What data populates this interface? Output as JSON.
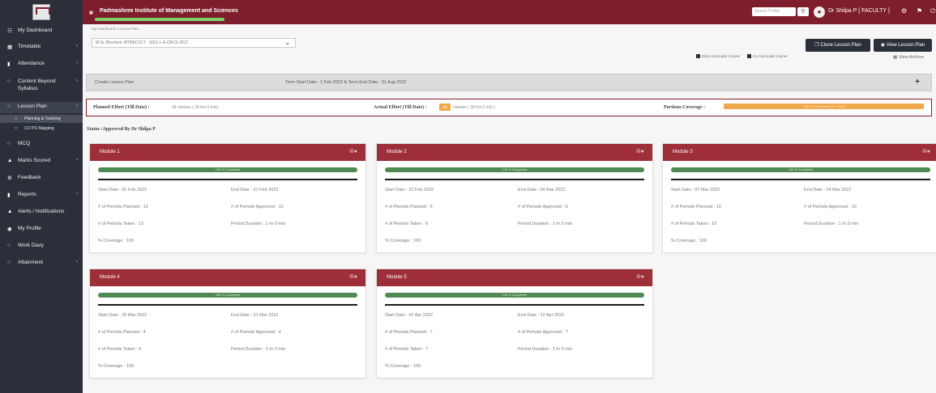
{
  "header": {
    "institute_name": "Padmashree Institute of Management and Sciences",
    "search_placeholder": "Search Profile",
    "user_label": "Dr Shilpa P [ FACULTY ]"
  },
  "sidebar": {
    "items": [
      {
        "label": "My Dashboard",
        "icon": "dashboard-icon"
      },
      {
        "label": "Timetable",
        "icon": "calendar-icon"
      },
      {
        "label": "Attendance",
        "icon": "chart-icon"
      },
      {
        "label": "Content Beyond Syllabus",
        "icon": "circle-icon"
      },
      {
        "label": "Lesson Plan",
        "icon": "circle-icon"
      },
      {
        "label": "Planning & Tracking",
        "icon": "circle-icon"
      },
      {
        "label": "CO PO Mapping",
        "icon": "circle-icon"
      },
      {
        "label": "MCQ",
        "icon": "circle-icon"
      },
      {
        "label": "Marks Scored",
        "icon": "user-icon"
      },
      {
        "label": "Feedback",
        "icon": "gear-icon"
      },
      {
        "label": "Reports",
        "icon": "file-icon"
      },
      {
        "label": "Alerts / Notifications",
        "icon": "bell-icon"
      },
      {
        "label": "My Profile",
        "icon": "user-circle-icon"
      },
      {
        "label": "Work Diary",
        "icon": "circle-icon"
      },
      {
        "label": "Attainment",
        "icon": "circle-icon"
      }
    ]
  },
  "main": {
    "breadcrumb": "My Dashboard / Lesson Plan",
    "course_select": "M.Sc Biochem: MTBEC1CT · 00(I)-1-A-CBCS-2017",
    "clone_button": "Clone Lesson Plan",
    "view_button": "View Lesson Plan",
    "legend_extra": "Extra Curricular Course",
    "legend_co": "Co-Curricular Course",
    "view_archive": "View Archive",
    "create_label": "Create Lesson Plan",
    "term_dates": "Term Start Date : 1 Feb 2022 & Term End Date : 31 Aug 2022",
    "planned_effort_label": "Planned Effort (Till Date) :",
    "planned_effort_value": "39 classes ( 39 hrs 0 min)",
    "actual_effort_label": "Actual Effort (Till Date) :",
    "actual_effort_badge": "39",
    "actual_effort_value": "classes ( 39 hrs 0 min )",
    "portions_label": "Portions Coverage :",
    "portions_value": "100 % Completed (On Track)",
    "portions_percent": 100,
    "status": "Status :Approved By Dr Shilpa P"
  },
  "modules": [
    {
      "title": "Module 1",
      "progress": "100 % Completed",
      "start": "Start Date : 01 Feb 2022",
      "end": "End Date : 21 Feb 2022",
      "planned": "# of Periods Planned : 12",
      "approved": "# of Periods Approved : 12",
      "taken": "# of Periods Taken : 12",
      "duration": "Period Duration : 1 hr 0 min",
      "coverage": "% Coverage : 100"
    },
    {
      "title": "Module 2",
      "progress": "100 % Completed",
      "start": "Start Date : 22 Feb 2022",
      "end": "End Date : 04 Mar 2022",
      "planned": "# of Periods Planned : 6",
      "approved": "# of Periods Approved : 6",
      "taken": "# of Periods Taken : 6",
      "duration": "Period Duration : 1 hr 0 min",
      "coverage": "% Coverage : 100"
    },
    {
      "title": "Module 3",
      "progress": "100 % Completed",
      "start": "Start Date : 07 Mar 2022",
      "end": "End Date : 24 Mar 2022",
      "planned": "# of Periods Planned : 10",
      "approved": "# of Periods Approved : 10",
      "taken": "# of Periods Taken : 10",
      "duration": "Period Duration : 1 hr 0 min",
      "coverage": "% Coverage : 100"
    },
    {
      "title": "Module 4",
      "progress": "100 % Completed",
      "start": "Start Date : 25 Mar 2022",
      "end": "End Date : 31 Mar 2022",
      "planned": "# of Periods Planned : 4",
      "approved": "# of Periods Approved : 4",
      "taken": "# of Periods Taken : 4",
      "duration": "Period Duration : 1 hr 0 min",
      "coverage": "% Coverage : 100"
    },
    {
      "title": "Module 5",
      "progress": "100 % Completed",
      "start": "Start Date : 01 Apr 2022",
      "end": "End Date : 12 Apr 2022",
      "planned": "# of Periods Planned : 7",
      "approved": "# of Periods Approved : 7",
      "taken": "# of Periods Taken : 7",
      "duration": "Period Duration : 1 hr 0 min",
      "coverage": "% Coverage : 100"
    }
  ]
}
